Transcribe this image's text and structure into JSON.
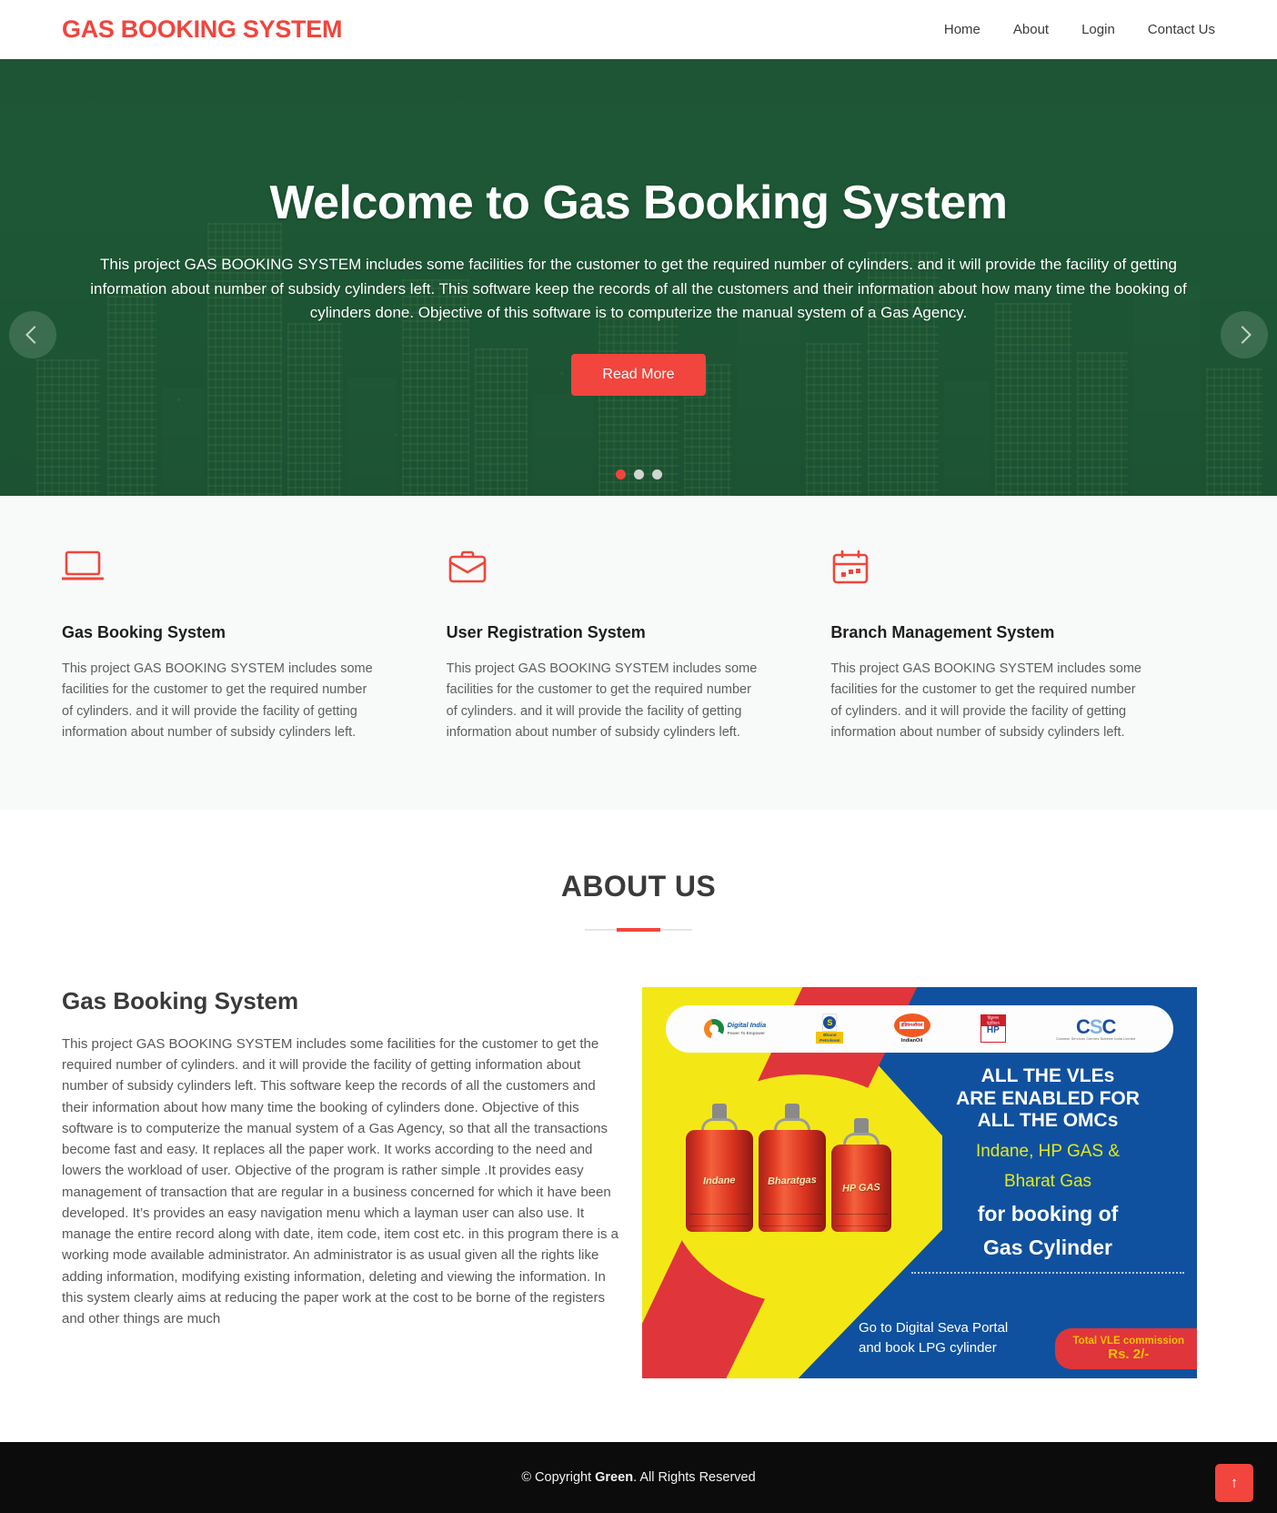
{
  "header": {
    "logo": "GAS BOOKING SYSTEM",
    "nav": [
      {
        "label": "Home"
      },
      {
        "label": "About"
      },
      {
        "label": "Login"
      },
      {
        "label": "Contact Us"
      }
    ]
  },
  "hero": {
    "title": "Welcome to Gas Booking System",
    "text": "This project GAS BOOKING SYSTEM includes some facilities for the customer to get the required number of cylinders. and it will provide the facility of getting information about number of subsidy cylinders left. This software keep the records of all the customers and their information about how many time the booking of cylinders done. Objective of this software is to computerize the manual system of a Gas Agency.",
    "button": "Read More",
    "prev_icon": "chevron-left-icon",
    "next_icon": "chevron-right-icon",
    "slides": 3,
    "active_slide": 1,
    "accent": "#f1453d",
    "overlay": "#21613c"
  },
  "features": [
    {
      "icon": "laptop-icon",
      "title": "Gas Booking System",
      "text": "This project GAS BOOKING SYSTEM includes some facilities for the customer to get the required number of cylinders. and it will provide the facility of getting information about number of subsidy cylinders left."
    },
    {
      "icon": "briefcase-icon",
      "title": "User Registration System",
      "text": "This project GAS BOOKING SYSTEM includes some facilities for the customer to get the required number of cylinders. and it will provide the facility of getting information about number of subsidy cylinders left."
    },
    {
      "icon": "calendar-icon",
      "title": "Branch Management System",
      "text": "This project GAS BOOKING SYSTEM includes some facilities for the customer to get the required number of cylinders. and it will provide the facility of getting information about number of subsidy cylinders left."
    }
  ],
  "about": {
    "heading": "ABOUT US",
    "title": "Gas Booking System",
    "text": "This project GAS BOOKING SYSTEM includes some facilities for the customer to get the required number of cylinders. and it will provide the facility of getting information about number of subsidy cylinders left. This software keep the records of all the customers and their information about how many time the booking of cylinders done. Objective of this software is to computerize the manual system of a Gas Agency, so that all the transactions become fast and easy. It replaces all the paper work. It works according to the need and lowers the workload of user. Objective of the program is rather simple .It provides easy management of transaction that are regular in a business concerned for which it have been developed. It’s provides an easy navigation menu which a layman user can also use. It manage the entire record along with date, item code, item cost etc. in this program there is a working mode available administrator. An administrator is as usual given all the rights like adding information, modifying existing information, deleting and viewing the information. In this system clearly aims at reducing the paper work at the cost to be borne of the registers and other things are much"
  },
  "poster": {
    "logos": [
      {
        "name": "Digital India",
        "tagline": "Power To Empower"
      },
      {
        "name": "Bharat Petroleum"
      },
      {
        "name": "IndianOil"
      },
      {
        "name": "HP"
      },
      {
        "name": "CSC",
        "tagline": "Common Services Centres Scheme India Limited"
      }
    ],
    "cylinders": [
      "Indane",
      "Bharatgas",
      "HP GAS"
    ],
    "headline_line1": "ALL THE VLEs",
    "headline_line2": "ARE ENABLED FOR",
    "headline_line3": "ALL THE OMCs",
    "brands_line1": "Indane, HP GAS &",
    "brands_line2": "Bharat Gas",
    "booking_line1": "for booking of",
    "booking_line2": "Gas Cylinder",
    "footer_line1": "Go to Digital Seva Portal",
    "footer_line2": "and book LPG cylinder",
    "badge_line1": "Total VLE commission",
    "badge_line2": "Rs. 2/-"
  },
  "footer": {
    "copyright_prefix": "© Copyright ",
    "brand": "Green",
    "copyright_suffix": ". All Rights Reserved",
    "to_top_icon": "↑"
  }
}
